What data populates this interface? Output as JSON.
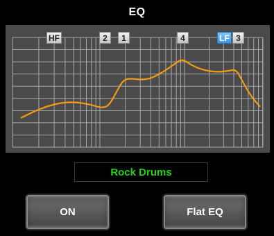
{
  "header": {
    "title": "EQ"
  },
  "eq": {
    "markers": [
      {
        "label": "HF",
        "active": false
      },
      {
        "label": "2",
        "active": false
      },
      {
        "label": "1",
        "active": false
      },
      {
        "label": "4",
        "active": false
      },
      {
        "label": "LF",
        "active": true
      },
      {
        "label": "3",
        "active": false
      }
    ],
    "curve_color": "#f39c12",
    "active_marker_color": "#3a96e6"
  },
  "preset": {
    "name": "Rock Drums",
    "color": "#22d418"
  },
  "buttons": {
    "on_label": "ON",
    "flat_label": "Flat EQ"
  }
}
